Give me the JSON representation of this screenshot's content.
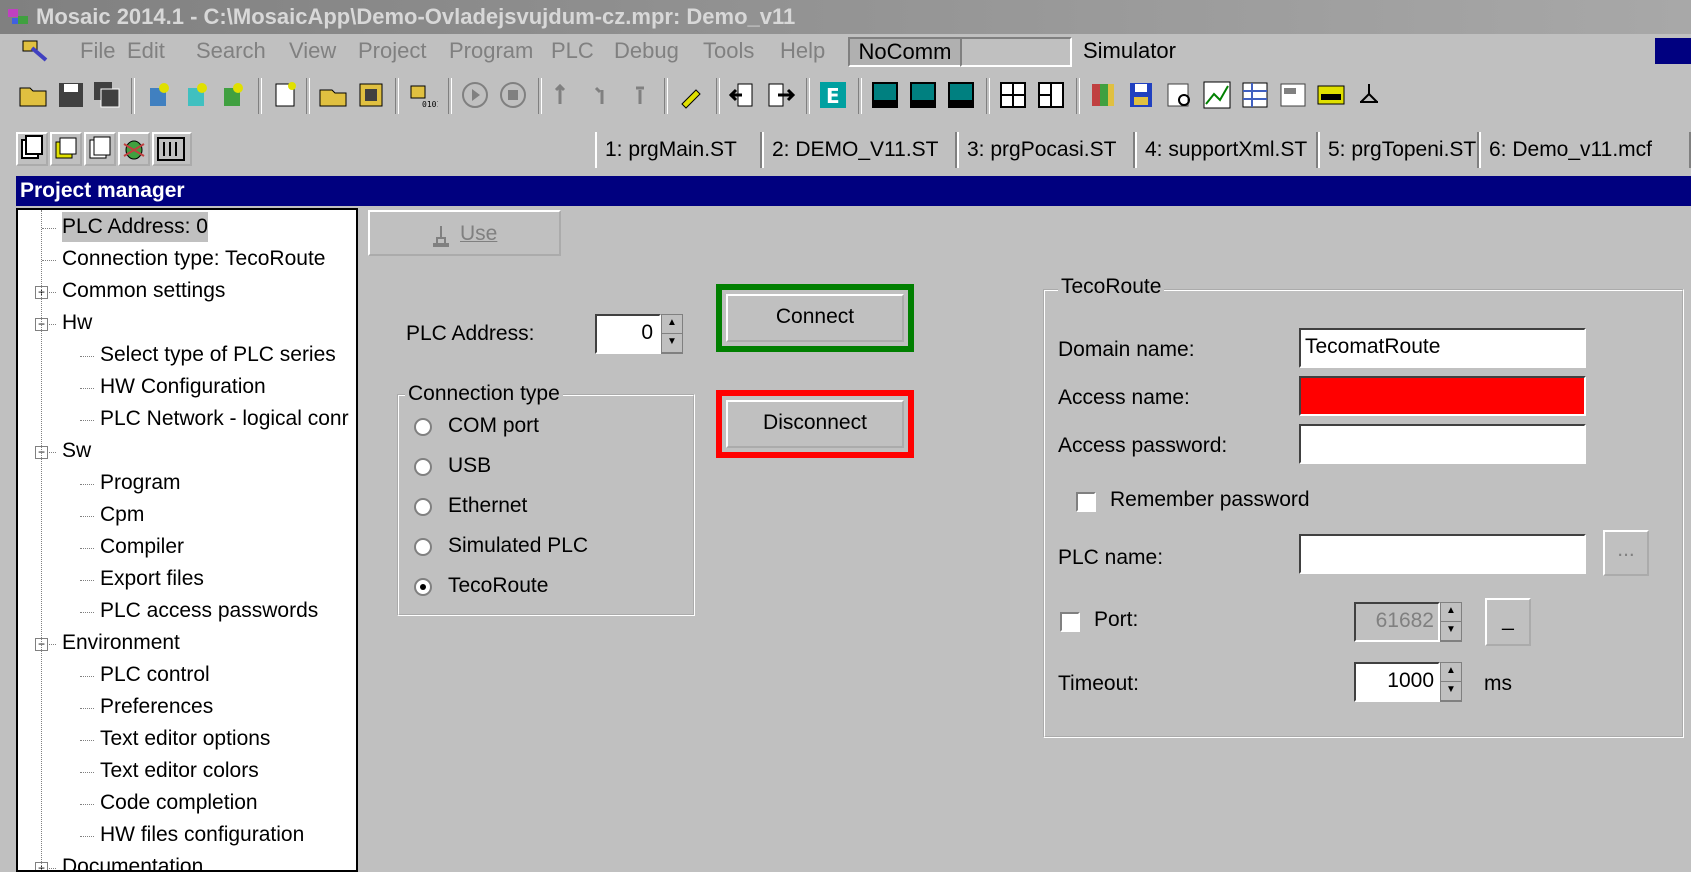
{
  "window": {
    "title": "Mosaic 2014.1 - C:\\MosaicApp\\Demo-Ovladejsvujdum-cz.mpr: Demo_v11"
  },
  "menu": {
    "items": [
      "File",
      "Edit",
      "Search",
      "View",
      "Project",
      "Program",
      "PLC",
      "Debug",
      "Tools",
      "Help"
    ],
    "comm_status": "NoComm",
    "mode": "Simulator"
  },
  "doc_tabs": [
    "1: prgMain.ST",
    "2: DEMO_V11.ST",
    "3: prgPocasi.ST",
    "4: supportXml.ST",
    "5: prgTopeni.ST",
    "6: Demo_v11.mcf"
  ],
  "project_manager": {
    "title": "Project manager",
    "tree": [
      {
        "label": "PLC Address: 0",
        "level": 0,
        "box": "",
        "selected": true
      },
      {
        "label": "Connection type: TecoRoute",
        "level": 0,
        "box": ""
      },
      {
        "label": "Common settings",
        "level": 0,
        "box": "+"
      },
      {
        "label": "Hw",
        "level": 0,
        "box": "-"
      },
      {
        "label": "Select type of PLC series",
        "level": 1,
        "box": ""
      },
      {
        "label": "HW Configuration",
        "level": 1,
        "box": ""
      },
      {
        "label": "PLC Network - logical conr",
        "level": 1,
        "box": ""
      },
      {
        "label": "Sw",
        "level": 0,
        "box": "-"
      },
      {
        "label": "Program",
        "level": 1,
        "box": ""
      },
      {
        "label": "Cpm",
        "level": 1,
        "box": ""
      },
      {
        "label": "Compiler",
        "level": 1,
        "box": ""
      },
      {
        "label": "Export files",
        "level": 1,
        "box": ""
      },
      {
        "label": "PLC access passwords",
        "level": 1,
        "box": ""
      },
      {
        "label": "Environment",
        "level": 0,
        "box": "-"
      },
      {
        "label": "PLC control",
        "level": 1,
        "box": ""
      },
      {
        "label": "Preferences",
        "level": 1,
        "box": ""
      },
      {
        "label": "Text editor options",
        "level": 1,
        "box": ""
      },
      {
        "label": "Text editor colors",
        "level": 1,
        "box": ""
      },
      {
        "label": "Code completion",
        "level": 1,
        "box": ""
      },
      {
        "label": "HW files configuration",
        "level": 1,
        "box": ""
      },
      {
        "label": "Documentation",
        "level": 0,
        "box": "+"
      }
    ]
  },
  "connection": {
    "use_label": "Use",
    "plc_address_label": "PLC Address:",
    "plc_address_value": "0",
    "connect_label": "Connect",
    "disconnect_label": "Disconnect",
    "connection_type_title": "Connection type",
    "connection_types": [
      "COM port",
      "USB",
      "Ethernet",
      "Simulated PLC",
      "TecoRoute"
    ],
    "selected_type": "TecoRoute"
  },
  "tecoroute": {
    "title": "TecoRoute",
    "domain_label": "Domain name:",
    "domain_value": "TecomatRoute",
    "access_name_label": "Access name:",
    "access_name_value": "",
    "access_password_label": "Access password:",
    "access_password_value": "",
    "remember_label": "Remember password",
    "remember_checked": false,
    "plc_name_label": "PLC name:",
    "plc_name_value": "",
    "browse_label": "...",
    "port_label": "Port:",
    "port_checked": false,
    "port_value": "61682",
    "port_reset_label": "_",
    "timeout_label": "Timeout:",
    "timeout_value": "1000",
    "timeout_unit": "ms"
  },
  "colors": {
    "connect_border": "#007f00",
    "disconnect_border": "#ff0000",
    "access_name_bg": "#ff0000",
    "header_bg": "#00007f"
  }
}
